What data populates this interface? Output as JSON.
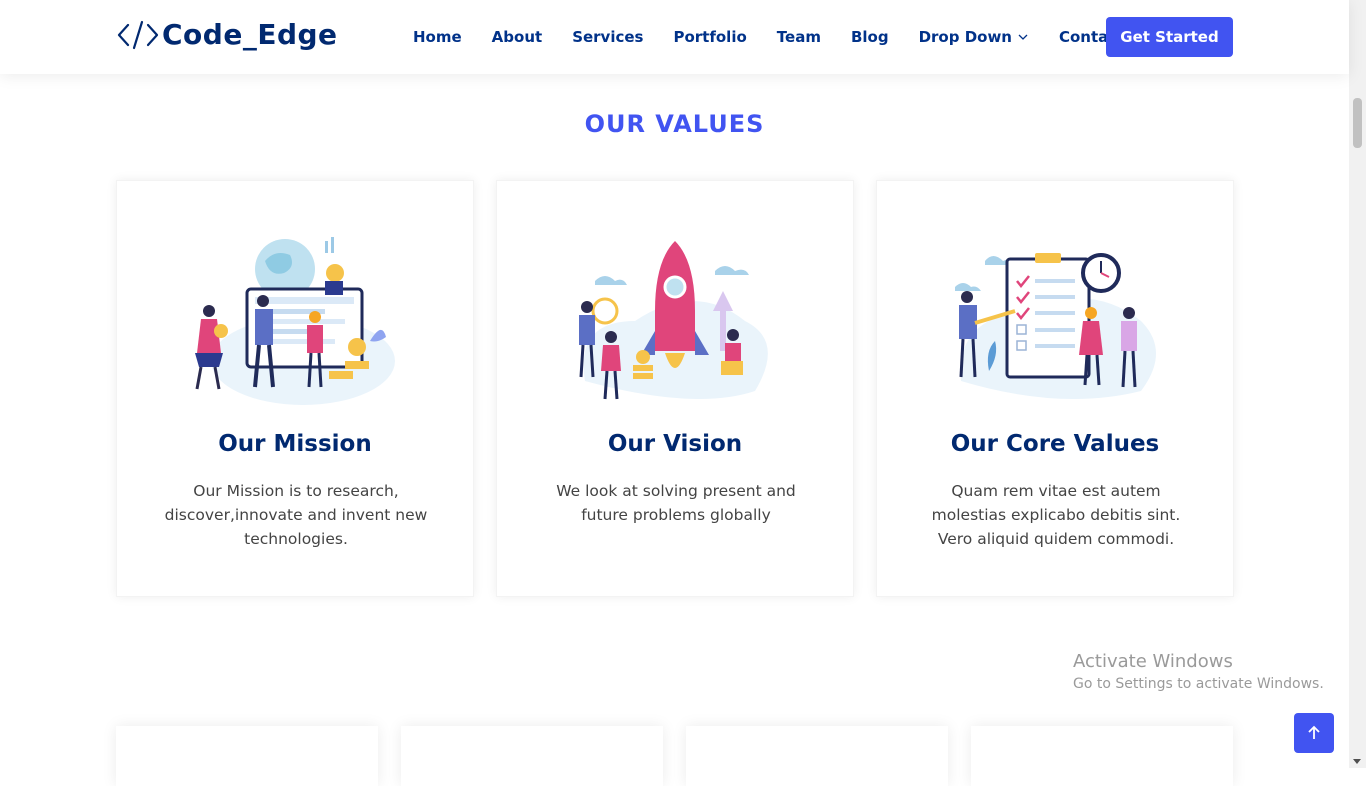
{
  "header": {
    "logo_text": "Code_Edge",
    "nav": [
      {
        "label": "Home"
      },
      {
        "label": "About"
      },
      {
        "label": "Services"
      },
      {
        "label": "Portfolio"
      },
      {
        "label": "Team"
      },
      {
        "label": "Blog"
      },
      {
        "label": "Drop Down"
      },
      {
        "label": "Contact"
      }
    ],
    "cta_label": "Get Started"
  },
  "values": {
    "title": "OUR VALUES",
    "cards": [
      {
        "title": "Our Mission",
        "text": "Our Mission is to research, discover,innovate and invent new technologies."
      },
      {
        "title": "Our Vision",
        "text": "We look at solving present and future problems globally"
      },
      {
        "title": "Our Core Values",
        "text": "Quam rem vitae est autem molestias explicabo debitis sint. Vero aliquid quidem commodi."
      }
    ]
  },
  "watermark": {
    "title": "Activate Windows",
    "subtitle": "Go to Settings to activate Windows."
  },
  "colors": {
    "accent": "#4154f1",
    "heading": "#012970",
    "nav_text": "#013289",
    "body_text": "#444444"
  },
  "icons": {
    "logo": "code-brackets-icon",
    "dropdown": "chevron-down-icon",
    "back_to_top": "arrow-up-icon"
  }
}
